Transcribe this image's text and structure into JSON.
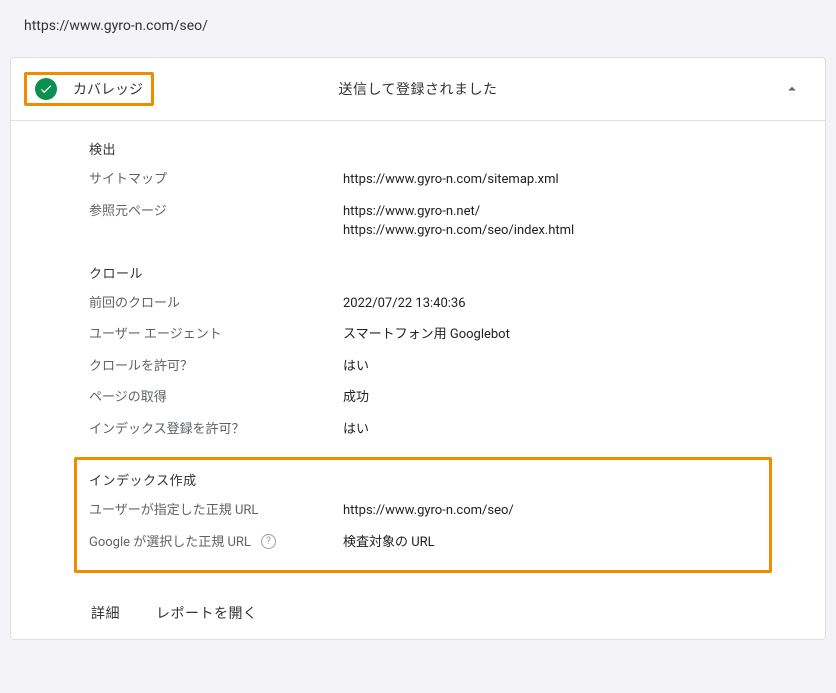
{
  "url": "https://www.gyro-n.com/seo/",
  "header": {
    "title": "カバレッジ",
    "status": "送信して登録されました"
  },
  "sections": {
    "detection": {
      "title": "検出",
      "sitemap": {
        "label": "サイトマップ",
        "value": "https://www.gyro-n.com/sitemap.xml"
      },
      "referrer": {
        "label": "参照元ページ",
        "value1": "https://www.gyro-n.net/",
        "value2": "https://www.gyro-n.com/seo/index.html"
      }
    },
    "crawl": {
      "title": "クロール",
      "lastCrawl": {
        "label": "前回のクロール",
        "value": "2022/07/22 13:40:36"
      },
      "userAgent": {
        "label": "ユーザー エージェント",
        "value": "スマートフォン用 Googlebot"
      },
      "crawlAllowed": {
        "label": "クロールを許可？",
        "value": "はい"
      },
      "pageFetch": {
        "label": "ページの取得",
        "value": "成功"
      },
      "indexAllowed": {
        "label": "インデックス登録を許可？",
        "value": "はい"
      }
    },
    "indexing": {
      "title": "インデックス作成",
      "userCanonical": {
        "label": "ユーザーが指定した正規 URL",
        "value": "https://www.gyro-n.com/seo/"
      },
      "googleCanonical": {
        "label": "Google が選択した正規 URL",
        "value": "検査対象の URL"
      }
    }
  },
  "footer": {
    "details": "詳細",
    "openReport": "レポートを開く"
  }
}
